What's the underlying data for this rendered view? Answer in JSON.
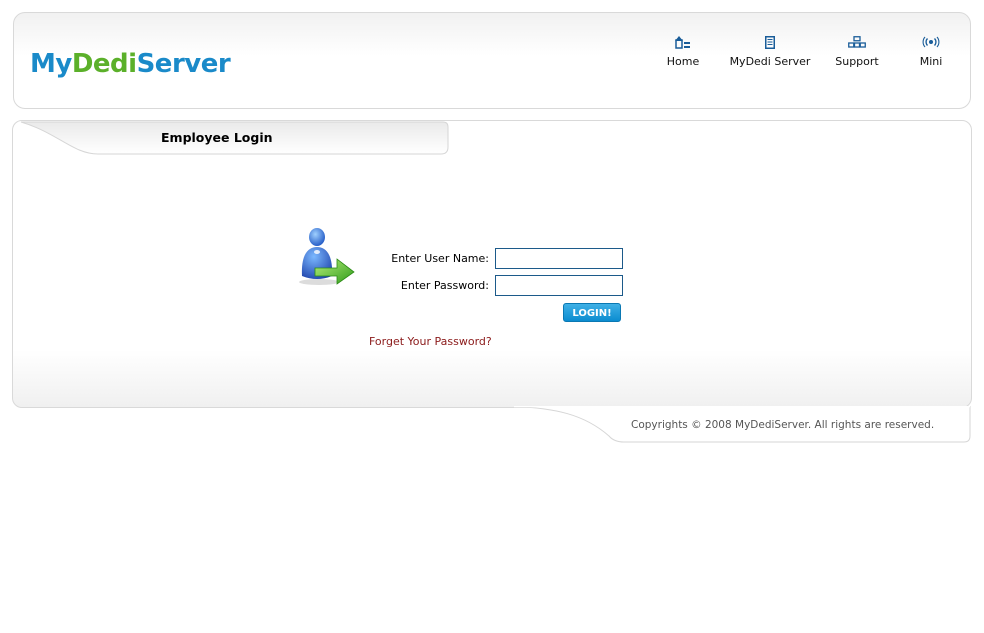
{
  "brand": {
    "part1": "My",
    "part2": "Dedi",
    "part3": "Server",
    "colors": {
      "blue": "#1a8ac9",
      "green": "#5bb02a"
    }
  },
  "nav": {
    "items": [
      {
        "label": "Home",
        "icon": "home-icon"
      },
      {
        "label": "MyDedi Server",
        "icon": "server-icon"
      },
      {
        "label": "Support",
        "icon": "support-icon"
      },
      {
        "label": "Mini",
        "icon": "mini-icon"
      }
    ]
  },
  "login": {
    "title": "Employee Login",
    "username_label": "Enter User Name:",
    "username_value": "",
    "password_label": "Enter Password:",
    "password_value": "",
    "button_label": "LOGIN!",
    "forgot_link": "Forget Your Password?",
    "icon": "user-login-icon"
  },
  "footer": {
    "copyright": "Copyrights © 2008 MyDediServer. All rights are reserved."
  }
}
